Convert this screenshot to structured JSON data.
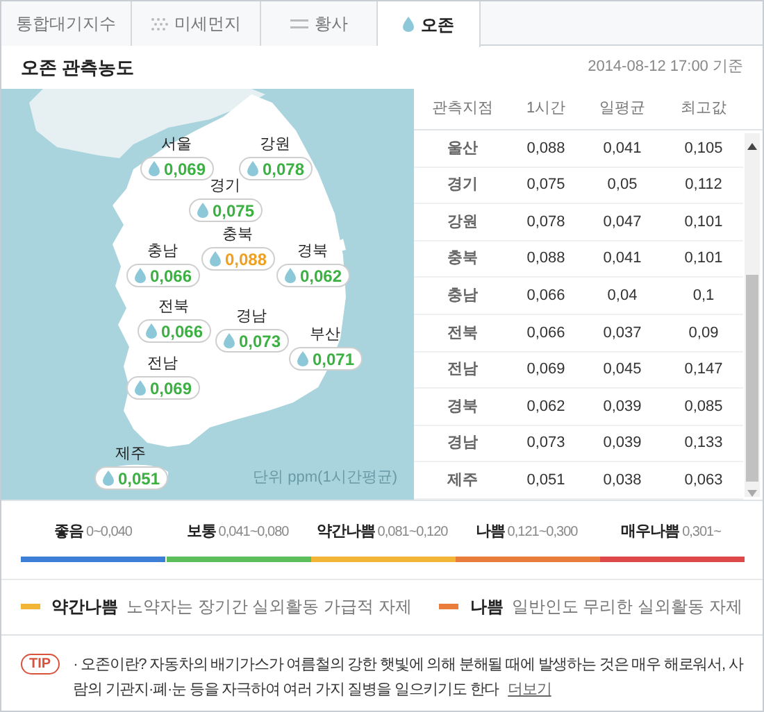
{
  "tabs": [
    {
      "label": "통합대기지수",
      "kind": "plain",
      "selected": false
    },
    {
      "label": "미세먼지",
      "kind": "dots",
      "selected": false
    },
    {
      "label": "황사",
      "kind": "lines",
      "selected": false
    },
    {
      "label": "오존",
      "kind": "drop",
      "selected": true
    }
  ],
  "title": "오존 관측농도",
  "timestamp": "2014-08-12 17:00 기준",
  "map": {
    "unit_note": "단위 ppm(1시간평균)",
    "regions": [
      {
        "name": "서울",
        "value": "0,069",
        "color": "#3cb043"
      },
      {
        "name": "강원",
        "value": "0,078",
        "color": "#3cb043"
      },
      {
        "name": "경기",
        "value": "0,075",
        "color": "#3cb043"
      },
      {
        "name": "충북",
        "value": "0,088",
        "color": "#f0a020"
      },
      {
        "name": "충남",
        "value": "0,066",
        "color": "#3cb043"
      },
      {
        "name": "경북",
        "value": "0,062",
        "color": "#3cb043"
      },
      {
        "name": "전북",
        "value": "0,066",
        "color": "#3cb043"
      },
      {
        "name": "경남",
        "value": "0,073",
        "color": "#3cb043"
      },
      {
        "name": "부산",
        "value": "0,071",
        "color": "#3cb043"
      },
      {
        "name": "전남",
        "value": "0,069",
        "color": "#3cb043"
      },
      {
        "name": "제주",
        "value": "0,051",
        "color": "#3cb043"
      }
    ]
  },
  "table": {
    "columns": [
      "관측지점",
      "1시간",
      "일평균",
      "최고값"
    ],
    "rows": [
      [
        "울산",
        "0,088",
        "0,041",
        "0,105"
      ],
      [
        "경기",
        "0,075",
        "0,05",
        "0,112"
      ],
      [
        "강원",
        "0,078",
        "0,047",
        "0,101"
      ],
      [
        "충북",
        "0,088",
        "0,041",
        "0,101"
      ],
      [
        "충남",
        "0,066",
        "0,04",
        "0,1"
      ],
      [
        "전북",
        "0,066",
        "0,037",
        "0,09"
      ],
      [
        "전남",
        "0,069",
        "0,045",
        "0,147"
      ],
      [
        "경북",
        "0,062",
        "0,039",
        "0,085"
      ],
      [
        "경남",
        "0,073",
        "0,039",
        "0,133"
      ],
      [
        "제주",
        "0,051",
        "0,038",
        "0,063"
      ]
    ]
  },
  "legend": [
    {
      "label": "좋음",
      "range": "0~0,040",
      "color": "#3d7fd6"
    },
    {
      "label": "보통",
      "range": "0,041~0,080",
      "color": "#5cbf5c"
    },
    {
      "label": "약간나쁨",
      "range": "0,081~0,120",
      "color": "#f2b535"
    },
    {
      "label": "나쁨",
      "range": "0,121~0,300",
      "color": "#ea7d3c"
    },
    {
      "label": "매우나쁨",
      "range": "0,301~",
      "color": "#df4848"
    }
  ],
  "advisories": [
    {
      "level": "약간나쁨",
      "text": "노약자는 장기간 실외활동 가급적 자제",
      "color": "#f2b535"
    },
    {
      "level": "나쁨",
      "text": "일반인도 무리한 실외활동 자제",
      "color": "#ea7d3c"
    }
  ],
  "tip": {
    "badge": "TIP",
    "text": "· 오존이란? 자동차의 배기가스가 여름철의 강한 햇빛에 의해 분해될 때에 발생하는 것은 매우 해로워서, 사람의 기관지·폐·눈 등을 자극하여 여러 가지 질병을 일으키기도 한다",
    "link": "더보기"
  }
}
